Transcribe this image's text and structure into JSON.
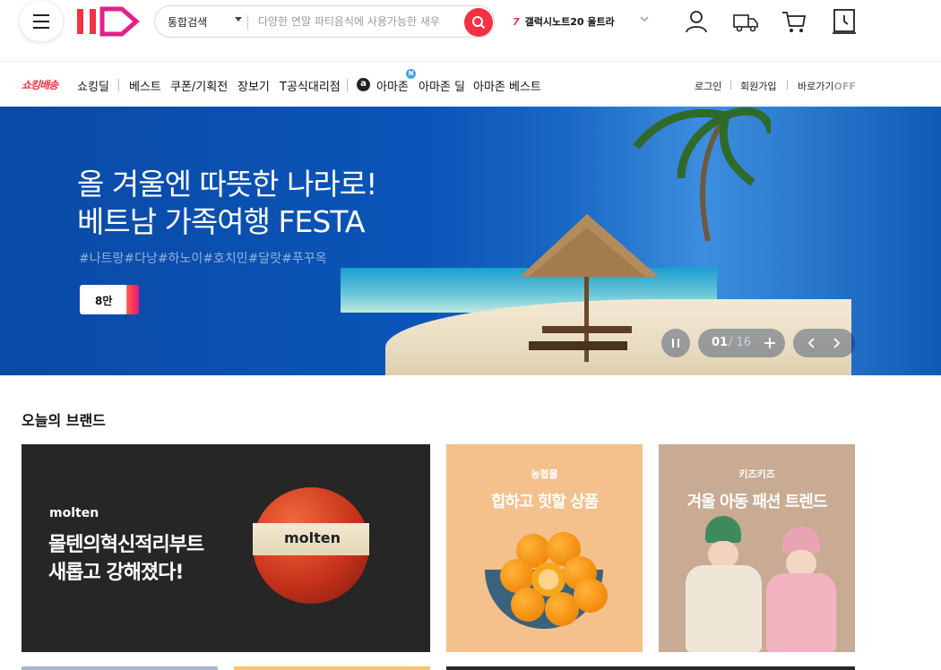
{
  "header": {
    "search_category": "통합검색",
    "search_placeholder": "다양한 연말 파티음식에 사용가능한 새우",
    "promo_number": "7",
    "promo_text": "갤럭시노트20 울트라"
  },
  "nav": {
    "shocking_label": "쇼킹배송",
    "items": [
      "쇼킹딜",
      "베스트",
      "쿠폰/기획전",
      "장보기",
      "T공식대리점"
    ],
    "amazon_logo": "a",
    "amazon_new_badge": "N",
    "amazon_items": [
      "아마존",
      "아마존 딜",
      "아마존 베스트"
    ],
    "utils": {
      "login": "로그인",
      "signup": "회원가입",
      "shortcut": "바로가기",
      "shortcut_state": "OFF"
    }
  },
  "hero": {
    "title_line1": "올 겨울엔 따뜻한 나라로!",
    "title_line2": "베트남 가족여행 FESTA",
    "tags": "#나트랑#다낭#하노이#호치민#달랏#푸꾸옥",
    "badge": "8만",
    "current": "01",
    "total": "/ 16"
  },
  "brands": {
    "section_title": "오늘의 브랜드",
    "cards": [
      {
        "brand": "molten",
        "line1": "몰텐의혁신적리부트",
        "line2": "새롭고 강해졌다!",
        "ball_text": "molten"
      },
      {
        "brand": "농협몰",
        "headline": "힙하고 힛할 상품"
      },
      {
        "brand": "키즈키즈",
        "headline": "겨울 아동 패션 트렌드"
      }
    ]
  },
  "colors": {
    "brand_red": "#f43142",
    "hero_blue": "#0b4aa6"
  }
}
